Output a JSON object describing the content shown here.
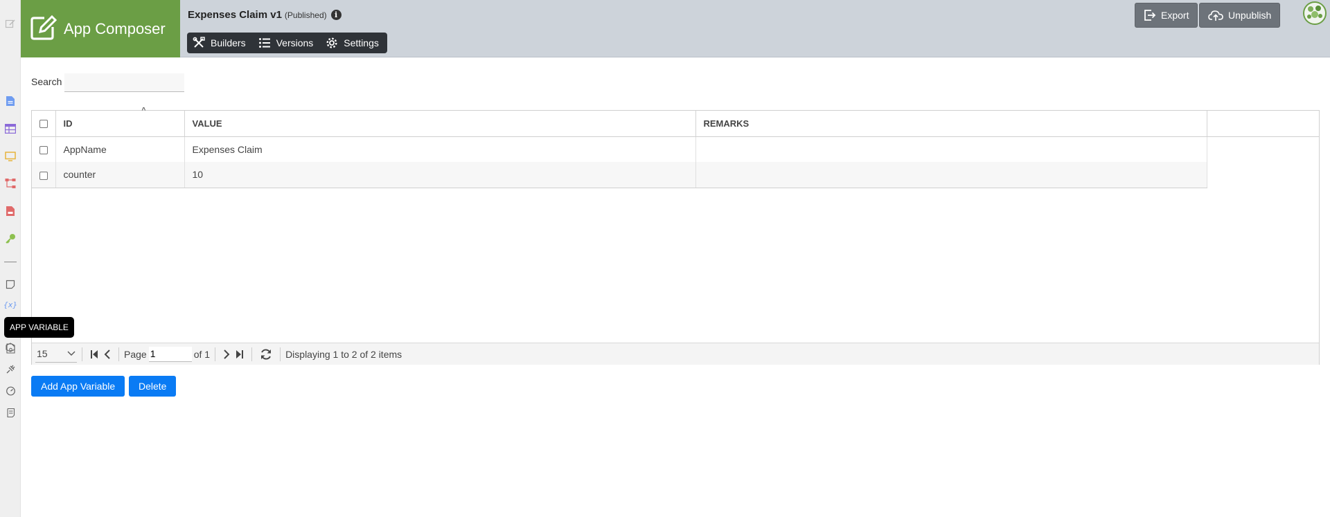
{
  "brand": {
    "title": "App Composer",
    "icon": "edit-square-icon"
  },
  "header": {
    "app_title": "Expenses Claim v1",
    "app_status": "(Published)",
    "nav": [
      {
        "label": "Builders",
        "icon": "tools-icon"
      },
      {
        "label": "Versions",
        "icon": "list-icon"
      },
      {
        "label": "Settings",
        "icon": "gear-icon"
      }
    ],
    "export_label": "Export",
    "unpublish_label": "Unpublish"
  },
  "sidebar": {
    "tooltip": "APP VARIABLE",
    "icons": [
      "edit-icon",
      "form-icon",
      "list-icon",
      "userview-icon",
      "process-icon",
      "report-icon",
      "key-icon",
      "note-icon",
      "app-variable-icon",
      "cube-icon",
      "resource-icon",
      "plugin-icon",
      "performance-icon",
      "logs-icon"
    ],
    "colors": {
      "form": "#6f9cf0",
      "list": "#8b6ad8",
      "userview": "#e7b43b",
      "process": "#e06a6a",
      "report": "#e06a6a",
      "key": "#8dc04f"
    }
  },
  "search": {
    "label": "Search",
    "value": ""
  },
  "table": {
    "columns": [
      "ID",
      "VALUE",
      "REMARKS"
    ],
    "rows": [
      {
        "id": "AppName",
        "value": "Expenses Claim",
        "remarks": ""
      },
      {
        "id": "counter",
        "value": "10",
        "remarks": ""
      }
    ]
  },
  "pager": {
    "page_size": "15",
    "page_label": "Page",
    "page_value": "1",
    "of_label": "of 1",
    "display_text": "Displaying 1 to 2 of 2 items"
  },
  "actions": {
    "add_label": "Add App Variable",
    "delete_label": "Delete"
  },
  "colors": {
    "brand_green": "#6b9e45",
    "topbar": "#cdd3da",
    "primary_blue": "#0a7bf4"
  }
}
